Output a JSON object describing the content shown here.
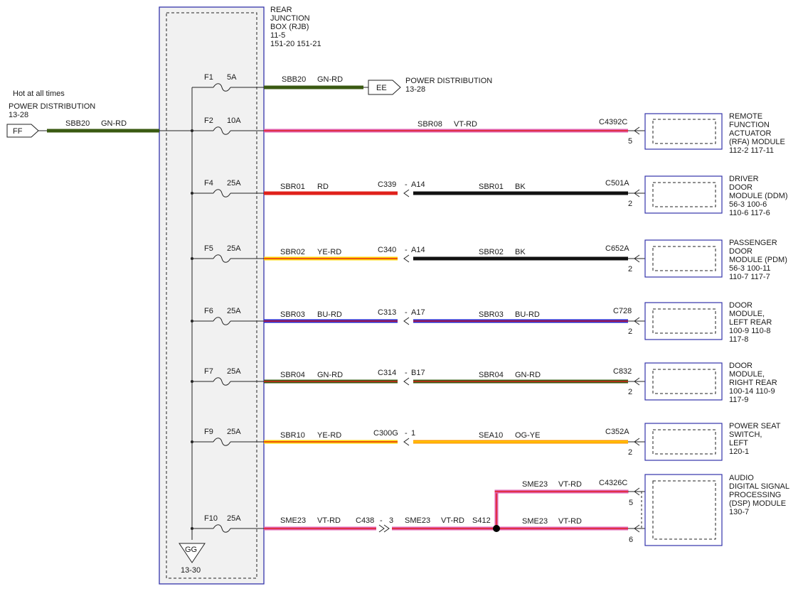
{
  "colors": {
    "GN": "#3a5a12",
    "RD": "#e0201a",
    "BK": "#111111",
    "YE": "#ffd400",
    "BU": "#2222cc",
    "VT": "#e060b0",
    "OG": "#ff9a00",
    "box_border": "#3333aa",
    "box_fill": "#f1f1f1"
  },
  "rjb": {
    "lines": [
      "REAR",
      "JUNCTION",
      "BOX (RJB)",
      "11-5",
      "151-20  151-21"
    ],
    "ground_tag": "GG",
    "ground_ref": "13-30"
  },
  "input": {
    "hot": "Hot at all times",
    "dest": "POWER DISTRIBUTION",
    "ref": "13-28",
    "conn": "FF",
    "circuit": "SBB20",
    "color": "GN-RD"
  },
  "output_ee": {
    "conn": "EE",
    "dest": "POWER DISTRIBUTION",
    "ref": "13-28",
    "circuit": "SBB20",
    "color": "GN-RD"
  },
  "fuses": [
    {
      "id": "F1",
      "amp": "5A"
    },
    {
      "id": "F2",
      "amp": "10A"
    },
    {
      "id": "F4",
      "amp": "25A"
    },
    {
      "id": "F5",
      "amp": "25A"
    },
    {
      "id": "F6",
      "amp": "25A"
    },
    {
      "id": "F7",
      "amp": "25A"
    },
    {
      "id": "F9",
      "amp": "25A"
    },
    {
      "id": "F10",
      "amp": "25A"
    }
  ],
  "circuits": [
    {
      "fuse": "F2",
      "left_circuit": "SBR08",
      "left_color": "VT-RD",
      "connector": "",
      "pin": "",
      "right_circuit": "",
      "right_color": "",
      "end_conn": "C4392C",
      "end_pin": "5",
      "module": [
        "REMOTE",
        "FUNCTION",
        "ACTUATOR",
        "(RFA) MODULE",
        "112-2    117-11"
      ]
    },
    {
      "fuse": "F4",
      "left_circuit": "SBR01",
      "left_color": "RD",
      "connector": "C339",
      "pin": "A14",
      "right_circuit": "SBR01",
      "right_color": "BK",
      "end_conn": "C501A",
      "end_pin": "2",
      "module": [
        "DRIVER",
        "DOOR",
        "MODULE (DDM)",
        "56-3     100-6",
        "110-6   117-6"
      ]
    },
    {
      "fuse": "F5",
      "left_circuit": "SBR02",
      "left_color": "YE-RD",
      "connector": "C340",
      "pin": "A14",
      "right_circuit": "SBR02",
      "right_color": "BK",
      "end_conn": "C652A",
      "end_pin": "2",
      "module": [
        "PASSENGER",
        "DOOR",
        "MODULE (PDM)",
        "56-3     100-11",
        "110-7   117-7"
      ]
    },
    {
      "fuse": "F6",
      "left_circuit": "SBR03",
      "left_color": "BU-RD",
      "connector": "C313",
      "pin": "A17",
      "right_circuit": "SBR03",
      "right_color": "BU-RD",
      "end_conn": "C728",
      "end_pin": "2",
      "module": [
        "DOOR",
        "MODULE,",
        "LEFT REAR",
        "100-9    110-8",
        "117-8"
      ]
    },
    {
      "fuse": "F7",
      "left_circuit": "SBR04",
      "left_color": "GN-RD",
      "connector": "C314",
      "pin": "B17",
      "right_circuit": "SBR04",
      "right_color": "GN-RD",
      "end_conn": "C832",
      "end_pin": "2",
      "module": [
        "DOOR",
        "MODULE,",
        "RIGHT REAR",
        "100-14    110-9",
        "117-9"
      ]
    },
    {
      "fuse": "F9",
      "left_circuit": "SBR10",
      "left_color": "YE-RD",
      "connector": "C300G",
      "pin": "1",
      "right_circuit": "SEA10",
      "right_color": "OG-YE",
      "end_conn": "C352A",
      "end_pin": "2",
      "module": [
        "POWER SEAT",
        "SWITCH,",
        "LEFT",
        "120-1"
      ]
    }
  ],
  "audio": {
    "fuse": "F10",
    "left_circuit": "SME23",
    "left_color": "VT-RD",
    "connector": "C438",
    "pin": "3",
    "mid_circuit": "SME23",
    "mid_color": "VT-RD",
    "splice": "S412",
    "top_circuit": "SME23",
    "top_color": "VT-RD",
    "bot_circuit": "SME23",
    "bot_color": "VT-RD",
    "end_conn": "C4326C",
    "pin_top": "5",
    "pin_bot": "6",
    "module": [
      "AUDIO",
      "DIGITAL SIGNAL",
      "PROCESSING",
      "(DSP) MODULE",
      "130-7"
    ]
  }
}
